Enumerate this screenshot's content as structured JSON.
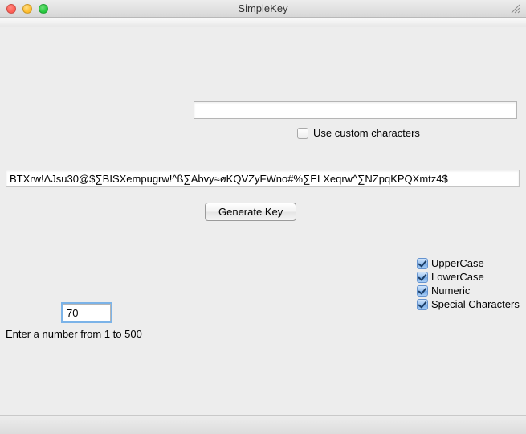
{
  "window": {
    "title": "SimpleKey"
  },
  "custom": {
    "input_value": "",
    "checkbox_label": "Use custom characters",
    "checked": false
  },
  "output_value": "BTXrw!ΔJsu30@$∑BISXempugrw!^ß∑Abvy≈øKQVZyFWno#%∑ELXeqrw^∑NZpqKPQXmtz4$",
  "generate_label": "Generate Key",
  "options": {
    "uppercase": {
      "label": "UpperCase",
      "checked": true
    },
    "lowercase": {
      "label": "LowerCase",
      "checked": true
    },
    "numeric": {
      "label": "Numeric",
      "checked": true
    },
    "special": {
      "label": "Special Characters",
      "checked": true
    }
  },
  "length": {
    "value": "70",
    "help": "Enter a number from 1 to 500"
  }
}
